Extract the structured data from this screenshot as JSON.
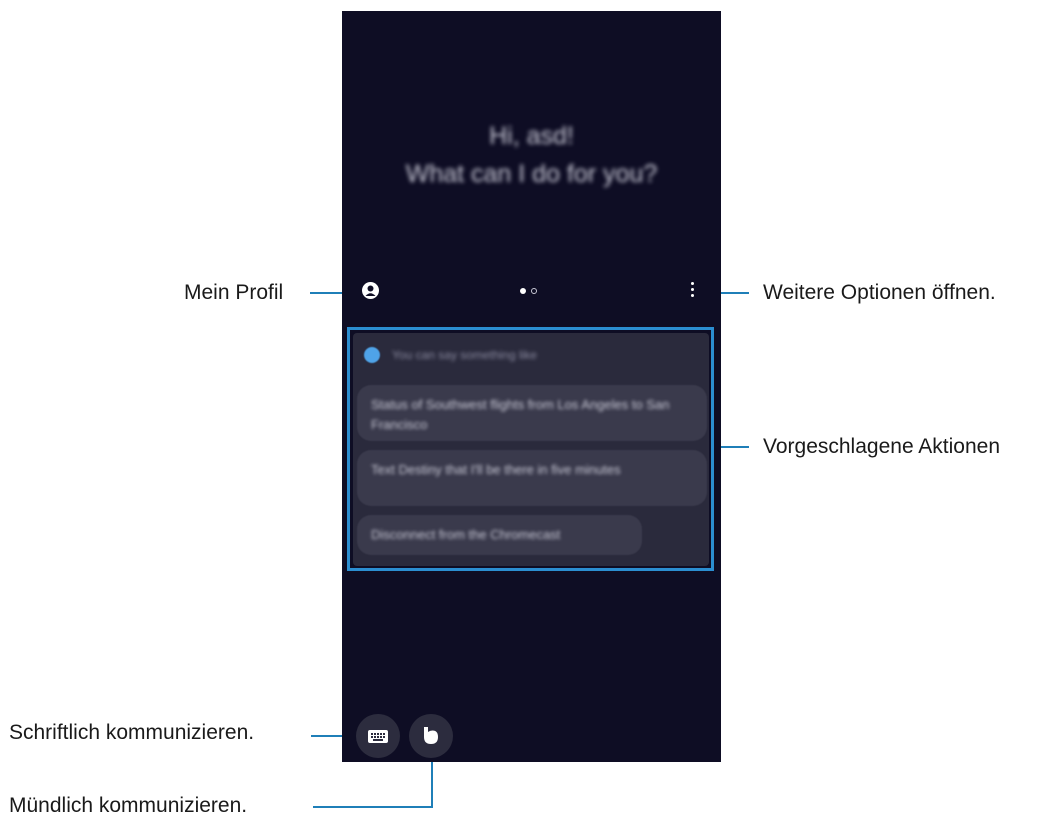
{
  "callouts": {
    "profile": "Mein Profil",
    "more_options": "Weitere Optionen öffnen.",
    "suggestions": "Vorgeschlagene Aktionen",
    "typing": "Schriftlich kommunizieren.",
    "voice": "Mündlich kommunizieren."
  },
  "screen": {
    "greeting_line1": "Hi, asd!",
    "greeting_line2": "What can I do for you?",
    "hint": "You can say something like",
    "suggestions": [
      "Status of Southwest flights from Los Angeles to San Francisco",
      "Text Destiny that I'll be there in five minutes",
      "Disconnect from the Chromecast"
    ],
    "page_dots": {
      "total": 2,
      "active": 1
    }
  },
  "icons": {
    "profile": "profile-icon",
    "more": "more-options-icon",
    "keyboard": "keyboard-icon",
    "bixby": "bixby-icon"
  },
  "colors": {
    "screen_bg": "#0e0d24",
    "callout_line": "#1f7fb8",
    "highlight_frame": "#2b8ed1"
  }
}
